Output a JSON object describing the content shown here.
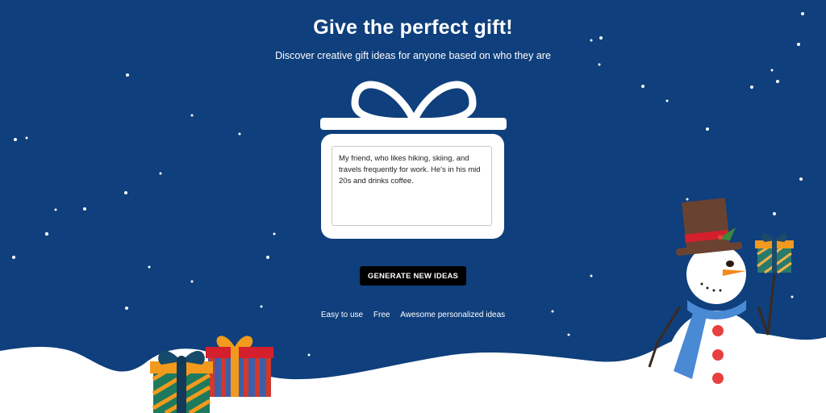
{
  "header": {
    "title": "Give the perfect gift!",
    "subtitle": "Discover creative gift ideas for anyone based on who they are"
  },
  "gift_box": {
    "description_value": "My friend, who likes hiking, skiing, and travels frequently for work. He's in his mid 20s and drinks coffee."
  },
  "actions": {
    "generate_label": "GENERATE NEW IDEAS"
  },
  "features": [
    "Easy to use",
    "Free",
    "Awesome personalized ideas"
  ],
  "colors": {
    "background": "#0f3f7c",
    "snow": "#ffffff",
    "button": "#000000"
  }
}
